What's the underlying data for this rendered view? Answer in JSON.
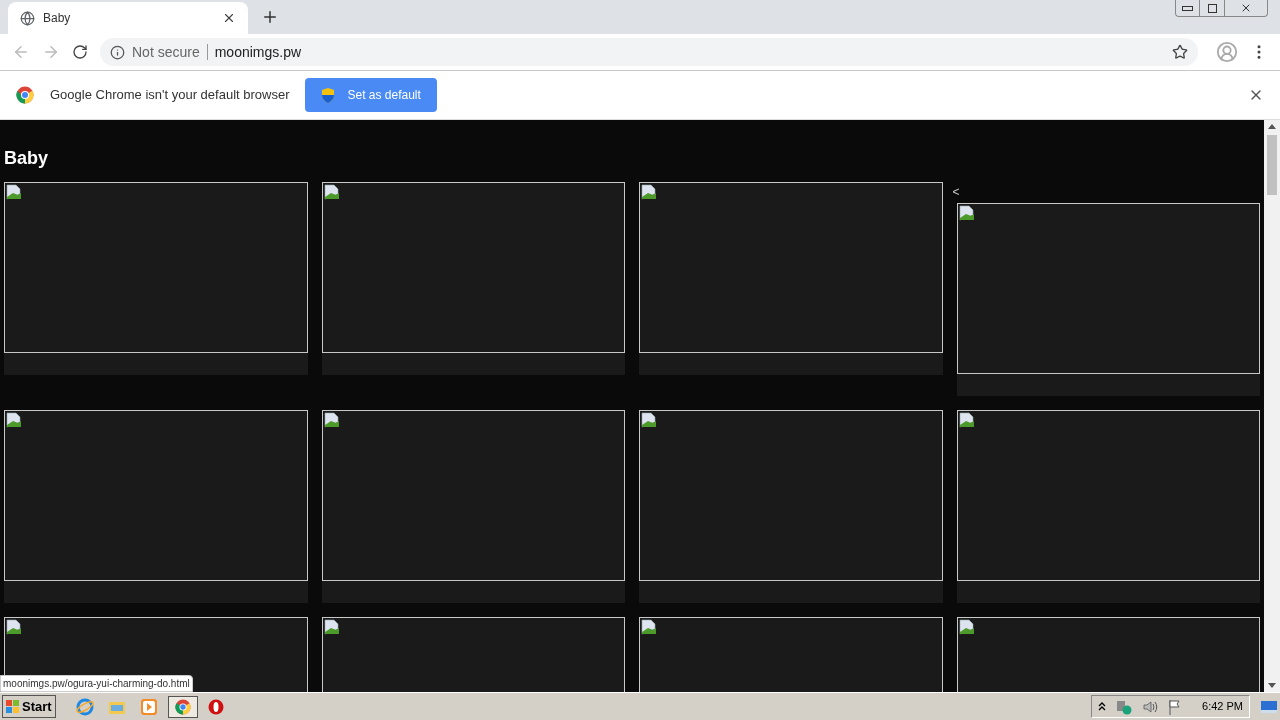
{
  "tab": {
    "title": "Baby"
  },
  "address": {
    "security": "Not secure",
    "url": "moonimgs.pw"
  },
  "infobar": {
    "message": "Google Chrome isn't your default browser",
    "button": "Set as default"
  },
  "page": {
    "heading": "Baby",
    "rows": [
      [
        {},
        {},
        {},
        {
          "prefix": "<"
        }
      ],
      [
        {},
        {},
        {},
        {}
      ],
      [
        {},
        {},
        {},
        {}
      ]
    ]
  },
  "status_url": "moonimgs.pw/ogura-yui-charming-do.html",
  "taskbar": {
    "start": "Start",
    "time": "6:42 PM"
  }
}
